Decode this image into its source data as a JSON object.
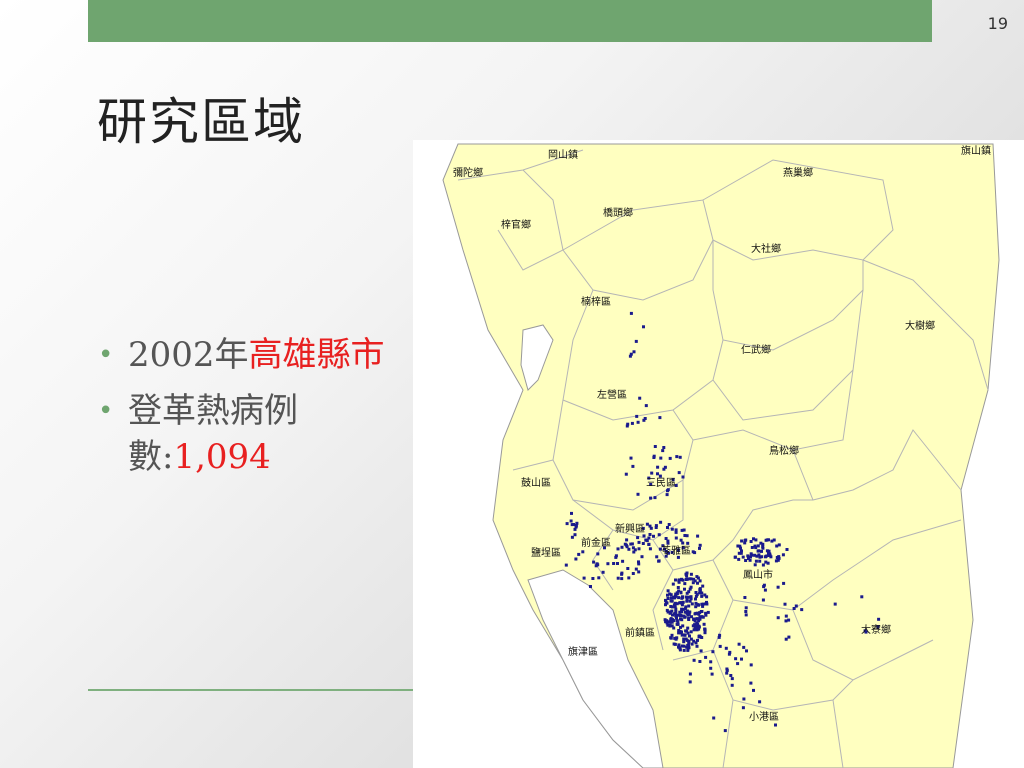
{
  "slide": {
    "number": "19",
    "title": "研究區域"
  },
  "bullets": [
    {
      "prefix": "2002年",
      "highlight": "高雄縣市",
      "suffix": ""
    },
    {
      "prefix": "登革熱病例數:",
      "highlight": "1,094",
      "suffix": ""
    }
  ],
  "colors": {
    "top_bar": "#6fa56f",
    "land": "#ffffc0",
    "boundary": "#b5b5b5",
    "case_dot": "#1a1a8c",
    "highlight_text": "#e82020"
  },
  "map": {
    "districts": [
      "岡山鎮",
      "旗山鎮",
      "彌陀鄉",
      "燕巢鄉",
      "梓官鄉",
      "橋頭鄉",
      "大社鄉",
      "楠梓區",
      "大樹鄉",
      "仁武鄉",
      "左營區",
      "鳥松鄉",
      "鼓山區",
      "三民區",
      "新興區",
      "前金區",
      "鹽埕區",
      "苓雅區",
      "鳳山市",
      "前鎮區",
      "旗津區",
      "大寮鄉",
      "小港區"
    ]
  }
}
